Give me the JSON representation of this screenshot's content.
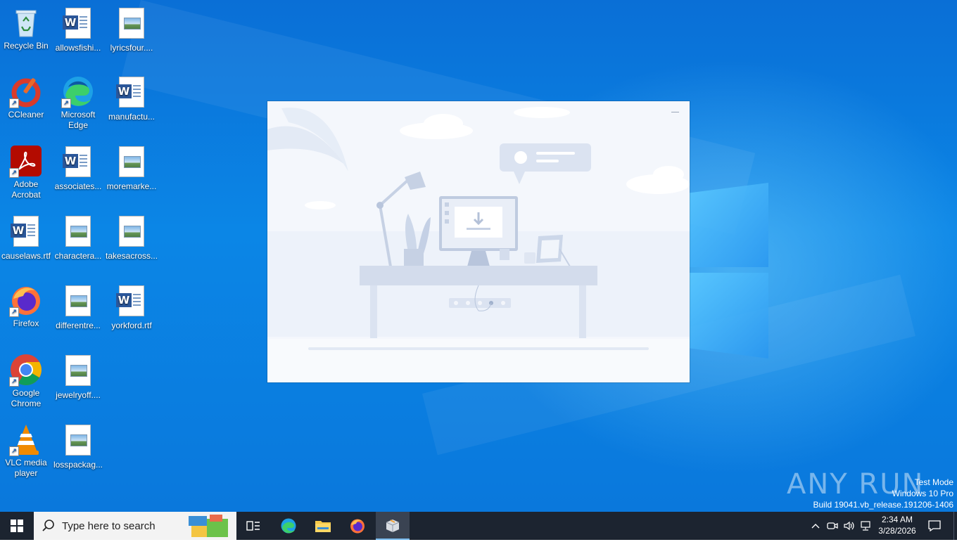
{
  "desktop": {
    "icons": [
      {
        "label": "Recycle Bin",
        "type": "recycle"
      },
      {
        "label": "allowsfishi...",
        "type": "word"
      },
      {
        "label": "lyricsfour....",
        "type": "doc"
      },
      {
        "label": "CCleaner",
        "type": "ccleaner"
      },
      {
        "label": "Microsoft Edge",
        "type": "edge"
      },
      {
        "label": "manufactu...",
        "type": "word"
      },
      {
        "label": "Adobe Acrobat",
        "type": "acrobat"
      },
      {
        "label": "associates...",
        "type": "word"
      },
      {
        "label": "moremarke...",
        "type": "doc"
      },
      {
        "label": "causelaws.rtf",
        "type": "word"
      },
      {
        "label": "charactera...",
        "type": "doc"
      },
      {
        "label": "takesacross...",
        "type": "doc"
      },
      {
        "label": "Firefox",
        "type": "firefox"
      },
      {
        "label": "differentre...",
        "type": "doc"
      },
      {
        "label": "yorkford.rtf",
        "type": "word"
      },
      {
        "label": "Google Chrome",
        "type": "chrome"
      },
      {
        "label": "jewelryoff....",
        "type": "doc"
      },
      {
        "label": "VLC media player",
        "type": "vlc"
      },
      {
        "label": "losspackag...",
        "type": "doc"
      }
    ]
  },
  "taskbar": {
    "search_placeholder": "Type here to search",
    "clock_time": "2:34 AM",
    "clock_date": "3/28/2026"
  },
  "watermark": {
    "brand": "ANY RUN",
    "line1": "Test Mode",
    "line2": "Windows 10 Pro",
    "line3": "Build 19041.vb_release.191206-1406"
  },
  "colors": {
    "taskbar": "#1c2430",
    "desktop_blue": "#0b86e6",
    "window_bg": "#f4f7fc"
  }
}
